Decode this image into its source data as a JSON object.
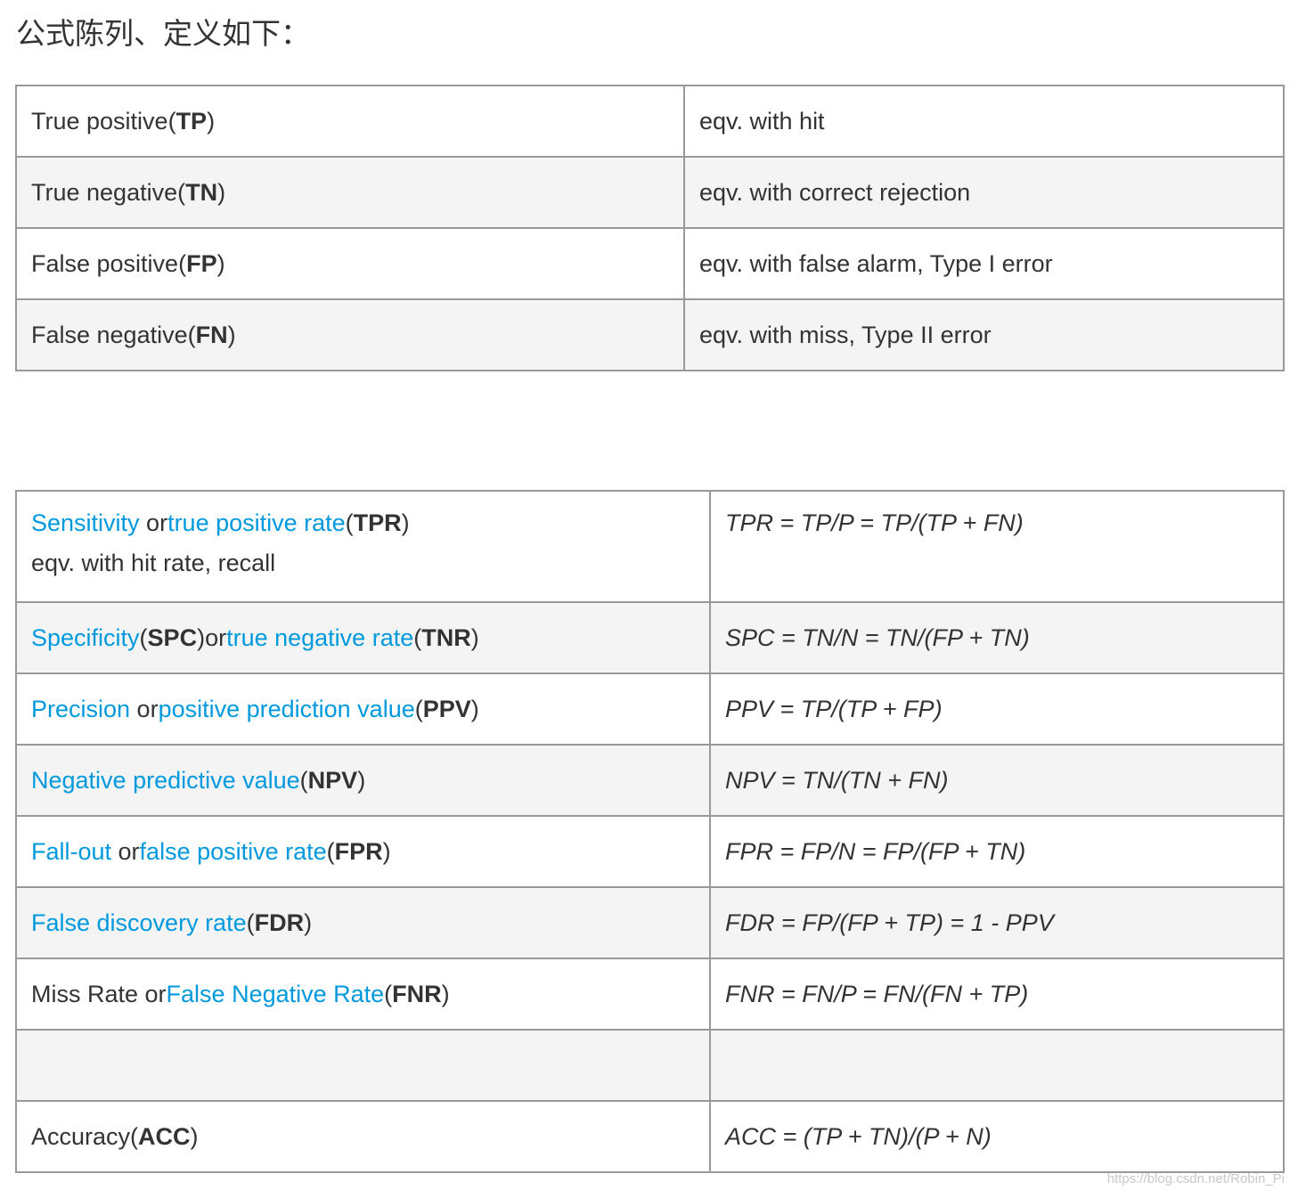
{
  "heading": "公式陈列、定义如下：",
  "table1": {
    "rows": [
      {
        "name": "True positive",
        "abbr": "TP",
        "desc": "eqv. with hit"
      },
      {
        "name": "True negative",
        "abbr": "TN",
        "desc": "eqv. with correct rejection"
      },
      {
        "name": "False positive",
        "abbr": "FP",
        "desc": "eqv. with false alarm, Type I error"
      },
      {
        "name": "False negative",
        "abbr": "FN",
        "desc": "eqv. with miss, Type II error"
      }
    ]
  },
  "table2": {
    "rows": [
      {
        "term1": "Sensitivity",
        "mid": " or",
        "term2": "true positive rate",
        "abbr": "TPR",
        "note": "eqv. with hit rate, recall",
        "formula": "TPR = TP/P = TP/(TP + FN)"
      },
      {
        "term1": "Specificity",
        "abbr1": "SPC",
        "mid": "or",
        "term2": "true negative rate",
        "abbr": "TNR",
        "formula": "SPC = TN/N = TN/(FP + TN)"
      },
      {
        "term1": "Precision",
        "mid": " or",
        "term2": "positive prediction value",
        "abbr": "PPV",
        "formula": "PPV = TP/(TP + FP)"
      },
      {
        "term1": "Negative predictive value",
        "abbr": "NPV",
        "formula": "NPV = TN/(TN + FN)"
      },
      {
        "term1": "Fall-out",
        "mid": " or",
        "term2": "false positive rate",
        "abbr": "FPR",
        "formula": "FPR = FP/N = FP/(FP + TN)"
      },
      {
        "term1": "False discovery rate",
        "abbr": "FDR",
        "formula": "FDR = FP/(FP + TP) = 1 - PPV"
      },
      {
        "prefix": "Miss Rate or",
        "term2": "False Negative Rate",
        "abbr": "FNR",
        "formula": "FNR = FN/P = FN/(FN + TP)"
      },
      {
        "empty": true
      },
      {
        "prefix": "Accuracy",
        "abbr": "ACC",
        "formula": "ACC = (TP + TN)/(P + N)"
      }
    ]
  },
  "watermark": "https://blog.csdn.net/Robin_Pi"
}
